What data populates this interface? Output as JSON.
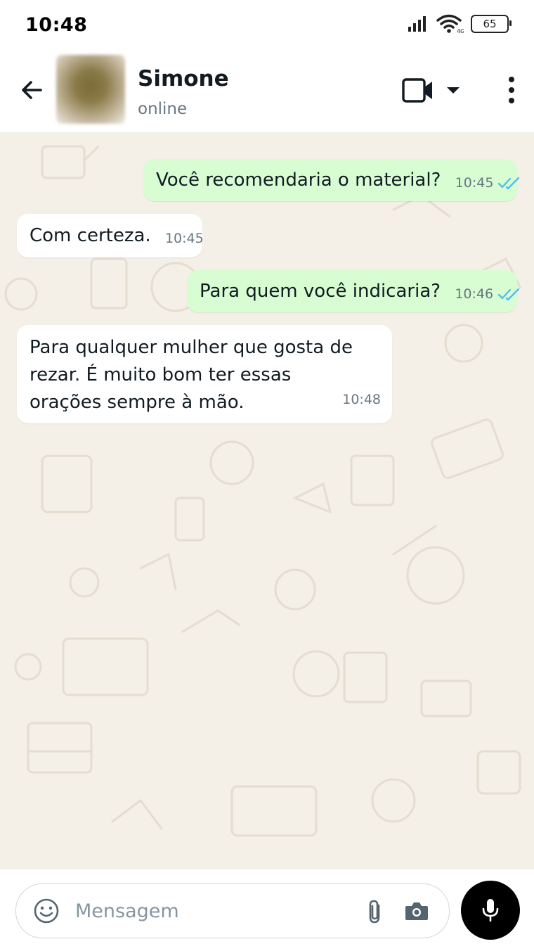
{
  "status_bar": {
    "time": "10:48",
    "battery": "65"
  },
  "header": {
    "contact_name": "Simone",
    "contact_status": "online"
  },
  "messages": [
    {
      "direction": "outgoing",
      "text": "Você recomendaria o material?",
      "time": "10:45",
      "read": true
    },
    {
      "direction": "incoming",
      "text": "Com certeza.",
      "time": "10:45"
    },
    {
      "direction": "outgoing",
      "text": "Para quem você indicaria?",
      "time": "10:46",
      "read": true
    },
    {
      "direction": "incoming",
      "text": "Para qualquer mulher que gosta de rezar. É muito bom ter essas orações sempre à mão.",
      "time": "10:48"
    }
  ],
  "composer": {
    "placeholder": "Mensagem"
  },
  "icons": {
    "back": "arrow-left-icon",
    "video": "video-call-icon",
    "dropdown": "caret-down-icon",
    "menu": "more-vertical-icon",
    "emoji": "emoji-icon",
    "attach": "paperclip-icon",
    "camera": "camera-icon",
    "mic": "microphone-icon",
    "ticks": "double-check-icon"
  },
  "colors": {
    "outgoing_bubble": "#d9fdd3",
    "incoming_bubble": "#ffffff",
    "read_ticks": "#53bdeb",
    "chat_background": "#f4f0e7"
  }
}
